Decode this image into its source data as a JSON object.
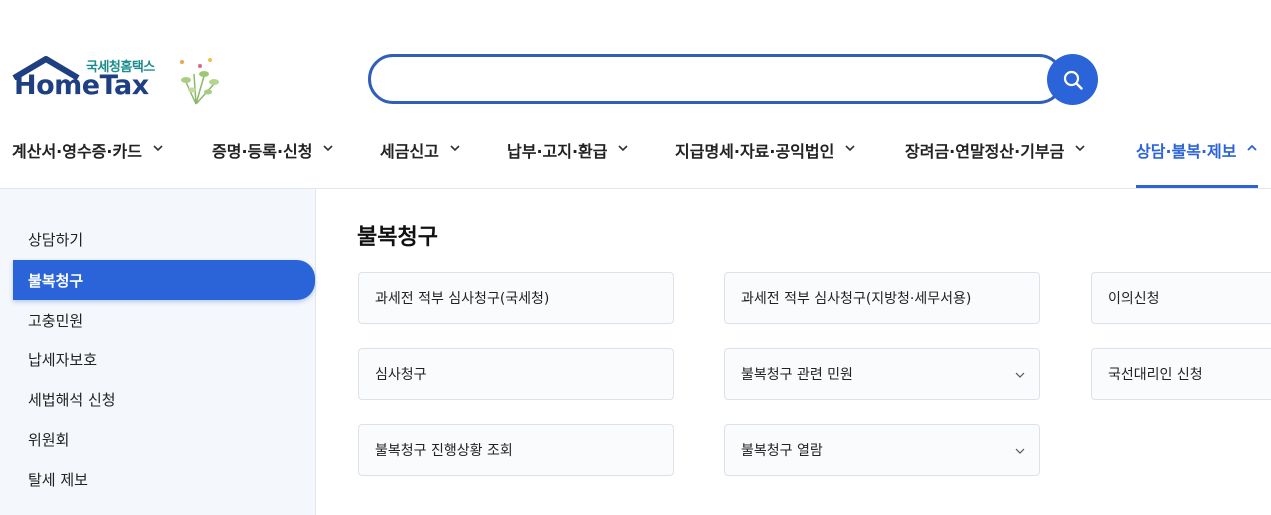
{
  "header": {
    "logo_sub": "국세청홈택스",
    "logo_main": "HomeTax",
    "search_placeholder": ""
  },
  "nav": {
    "items": [
      {
        "label": "계산서·영수증·카드",
        "icon": "chevron-down-icon"
      },
      {
        "label": "증명·등록·신청",
        "icon": "chevron-down-icon"
      },
      {
        "label": "세금신고",
        "icon": "chevron-down-icon"
      },
      {
        "label": "납부·고지·환급",
        "icon": "chevron-down-icon"
      },
      {
        "label": "지급명세·자료·공익법인",
        "icon": "chevron-down-icon"
      },
      {
        "label": "장려금·연말정산·기부금",
        "icon": "chevron-down-icon"
      },
      {
        "label": "상담·불복·제보",
        "icon": "chevron-up-icon",
        "active": true
      }
    ]
  },
  "sidebar": {
    "items": [
      {
        "label": "상담하기"
      },
      {
        "label": "불복청구",
        "active": true
      },
      {
        "label": "고충민원"
      },
      {
        "label": "납세자보호"
      },
      {
        "label": "세법해석 신청"
      },
      {
        "label": "위원회"
      },
      {
        "label": "탈세 제보"
      }
    ]
  },
  "main": {
    "title": "불복청구",
    "cards": [
      {
        "label": "과세전 적부 심사청구(국세청)",
        "expandable": false
      },
      {
        "label": "과세전 적부 심사청구(지방청·세무서용)",
        "expandable": false
      },
      {
        "label": "이의신청",
        "expandable": false
      },
      {
        "label": "심사청구",
        "expandable": false
      },
      {
        "label": "불복청구 관련 민원",
        "expandable": true
      },
      {
        "label": "국선대리인 신청",
        "expandable": false
      },
      {
        "label": "불복청구 진행상황 조회",
        "expandable": false
      },
      {
        "label": "불복청구 열람",
        "expandable": true
      }
    ]
  },
  "colors": {
    "accent": "#2b64d8",
    "logo_navy": "#1e3f82",
    "logo_teal": "#1a8c8c",
    "sidebar_bg": "#f4f7fb"
  }
}
